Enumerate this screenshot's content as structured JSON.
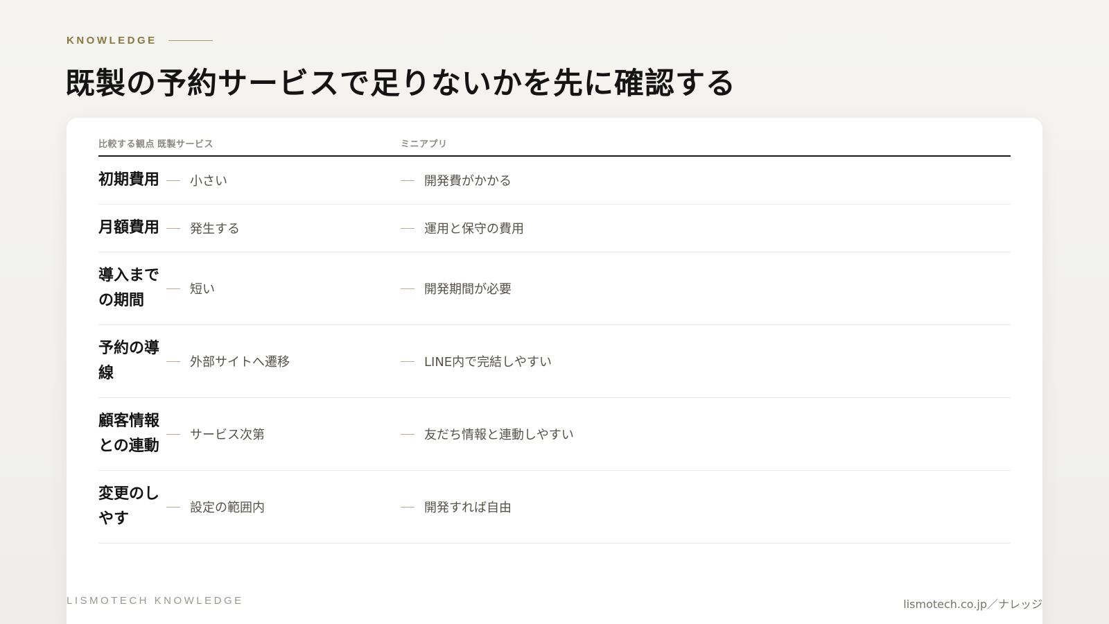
{
  "eyebrow": "KNOWLEDGE",
  "title": "既製の予約サービスで足りないかを先に確認する",
  "table": {
    "header_aspect": "比較する観点",
    "header_existing": "既製サービス",
    "header_mini": "ミニアプリ",
    "rows": [
      {
        "label": "初期費用",
        "existing": "小さい",
        "mini": "開発費がかかる"
      },
      {
        "label": "月額費用",
        "existing": "発生する",
        "mini": "運用と保守の費用"
      },
      {
        "label": "導入までの期間",
        "existing": "短い",
        "mini": "開発期間が必要"
      },
      {
        "label": "予約の導線",
        "existing": "外部サイトへ遷移",
        "mini": "LINE内で完結しやすい"
      },
      {
        "label": "顧客情報との連動",
        "existing": "サービス次第",
        "mini": "友だち情報と連動しやすい"
      },
      {
        "label": "変更のしやす",
        "existing": "設定の範囲内",
        "mini": "開発すれば自由"
      }
    ]
  },
  "footer": {
    "brand": "LISMOTECH KNOWLEDGE",
    "site": "lismotech.co.jp／ナレッジ"
  }
}
